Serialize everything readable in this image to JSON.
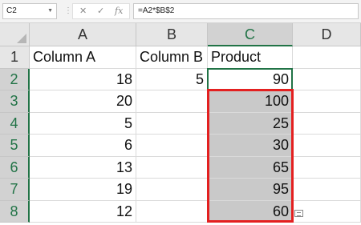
{
  "formula_bar": {
    "name_box": "C2",
    "formula": "=A2*$B$2",
    "cancel_glyph": "✕",
    "enter_glyph": "✓",
    "fx_label": "fx"
  },
  "columns": [
    "A",
    "B",
    "C",
    "D"
  ],
  "rows": [
    "1",
    "2",
    "3",
    "4",
    "5",
    "6",
    "7",
    "8"
  ],
  "cells": {
    "A1": "Column A",
    "B1": "Column B",
    "C1": "Product",
    "A2": "18",
    "B2": "5",
    "C2": "90",
    "A3": "20",
    "C3": "100",
    "A4": "5",
    "C4": "25",
    "A5": "6",
    "C5": "30",
    "A6": "13",
    "C6": "65",
    "A7": "19",
    "C7": "95",
    "A8": "12",
    "C8": "60"
  },
  "colors": {
    "selection_green": "#217346",
    "highlight_red": "#e32020",
    "fill_gray": "#c9c9c9"
  }
}
